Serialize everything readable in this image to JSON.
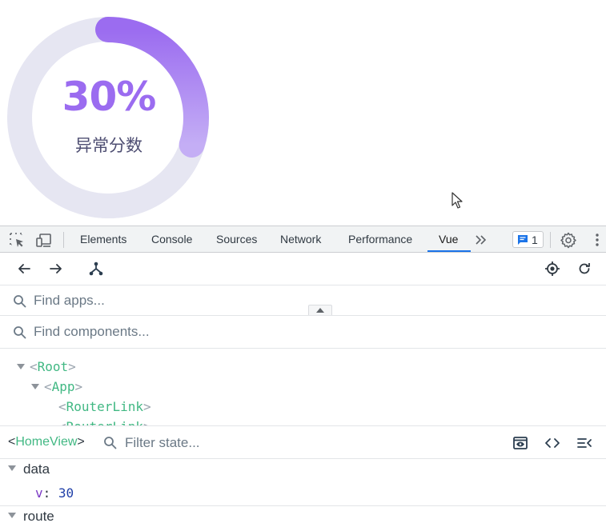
{
  "page": {
    "gauge": {
      "value_text": "30%",
      "progress": 0.3,
      "label": "异常分数"
    },
    "colors": {
      "gauge_track": "#e6e6f2",
      "gauge_start": "#9b6cf0",
      "gauge_end": "#c4aef5",
      "text_value": "#9b6cf0",
      "text_label": "#4e4e72"
    }
  },
  "devtools": {
    "tabs": [
      {
        "label": "Elements"
      },
      {
        "label": "Console"
      },
      {
        "label": "Sources"
      },
      {
        "label": "Network"
      },
      {
        "label": "Performance"
      },
      {
        "label": "Vue",
        "active": true
      }
    ],
    "issues_count": "1",
    "accent": "#1a73e8"
  },
  "vue": {
    "find_apps_placeholder": "Find apps...",
    "find_components_placeholder": "Find components...",
    "tree": {
      "root": "Root",
      "app": "App",
      "link1": "RouterLink",
      "link2": "RouterLink"
    },
    "inspector": {
      "selected_component": "HomeView",
      "open_bracket": "<",
      "close_bracket": ">",
      "filter_placeholder": "Filter state..."
    },
    "state": {
      "data_label": "data",
      "prop_key": "v",
      "prop_colon": ":",
      "prop_value": "30",
      "route_label": "route"
    },
    "brackets": {
      "open": "<",
      "close": ">"
    },
    "component_color": "#41b883"
  }
}
